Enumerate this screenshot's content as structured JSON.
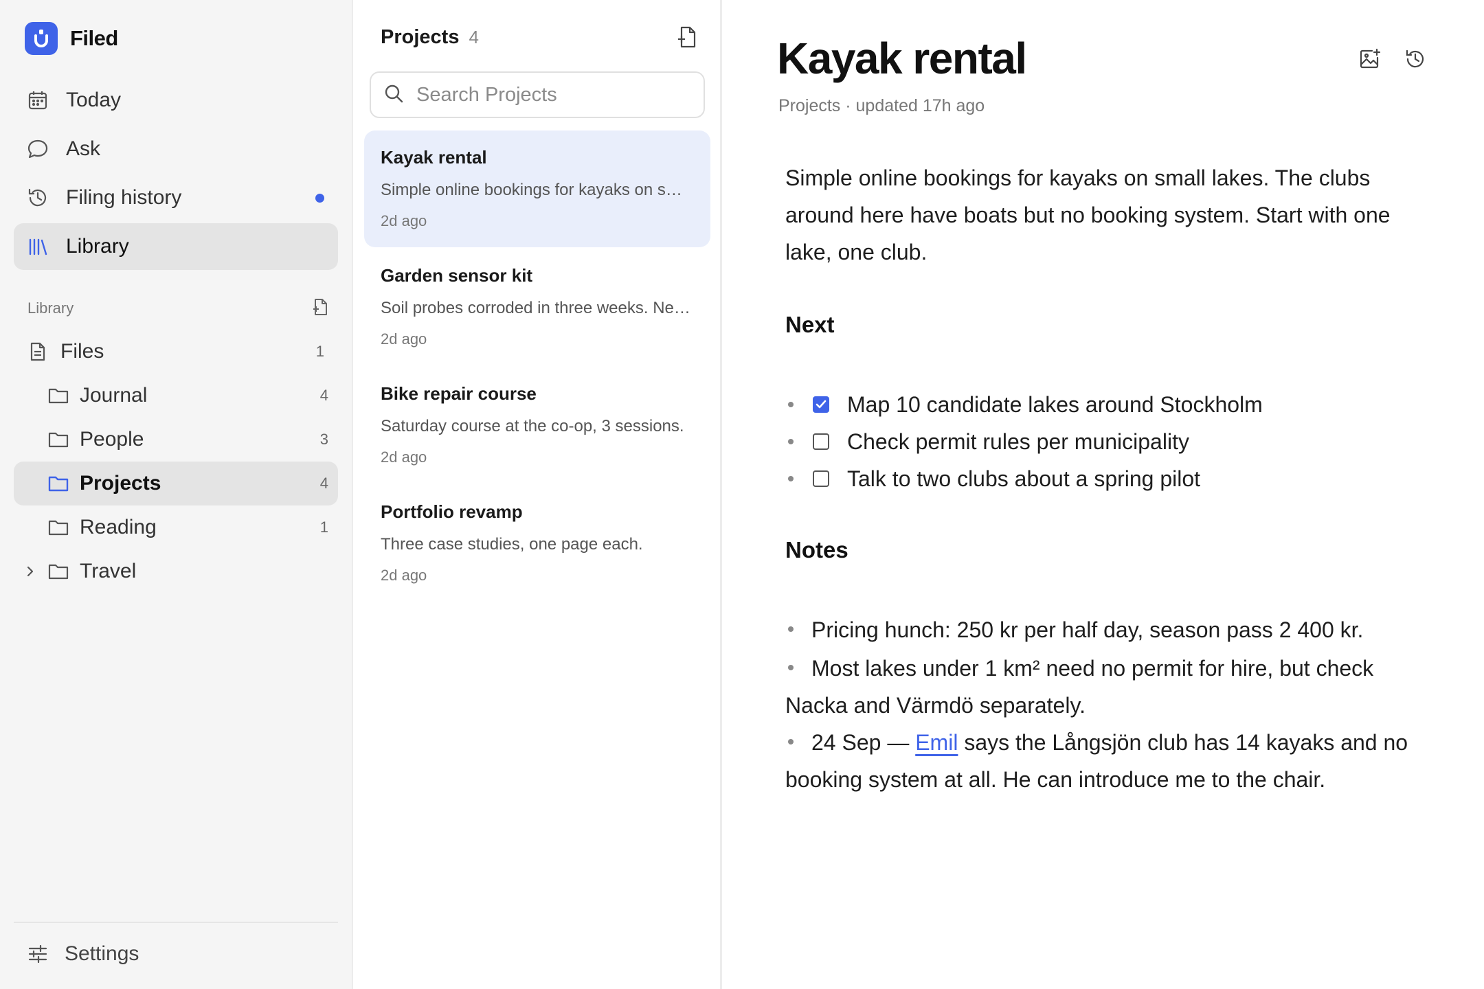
{
  "app": {
    "name": "Filed",
    "accent": "#3f63e8"
  },
  "sidebar": {
    "nav": [
      {
        "label": "Today",
        "icon": "calendar-icon"
      },
      {
        "label": "Ask",
        "icon": "chat-bubble-icon"
      },
      {
        "label": "Filing history",
        "icon": "history-icon",
        "has_unread_dot": true
      },
      {
        "label": "Library",
        "icon": "library-icon",
        "active": true
      }
    ],
    "library_header": "Library",
    "tree": [
      {
        "label": "Files",
        "count": "1",
        "icon": "file-icon"
      },
      {
        "label": "Journal",
        "count": "4",
        "icon": "folder-icon"
      },
      {
        "label": "People",
        "count": "3",
        "icon": "folder-icon"
      },
      {
        "label": "Projects",
        "count": "4",
        "icon": "folder-icon",
        "active": true
      },
      {
        "label": "Reading",
        "count": "1",
        "icon": "folder-icon"
      },
      {
        "label": "Travel",
        "count": "",
        "icon": "folder-icon",
        "collapsed": true
      }
    ],
    "settings_label": "Settings"
  },
  "list": {
    "title": "Projects",
    "count": "4",
    "search_placeholder": "Search Projects",
    "items": [
      {
        "title": "Kayak rental",
        "snippet": "Simple online bookings for kayaks on small lakes.",
        "time": "2d ago",
        "active": true
      },
      {
        "title": "Garden sensor kit",
        "snippet": "Soil probes corroded in three weeks. Need a better coating.",
        "time": "2d ago"
      },
      {
        "title": "Bike repair course",
        "snippet": "Saturday course at the co-op, 3 sessions.",
        "time": "2d ago"
      },
      {
        "title": "Portfolio revamp",
        "snippet": "Three case studies, one page each.",
        "time": "2d ago"
      }
    ]
  },
  "document": {
    "title": "Kayak rental",
    "meta": "Projects · updated 17h ago",
    "intro": "Simple online bookings for kayaks on small lakes. The clubs around here have boats but no booking system. Start with one lake, one club.",
    "next_heading": "Next",
    "tasks": [
      {
        "text": "Map 10 candidate lakes around Stockholm",
        "done": true
      },
      {
        "text": "Check permit rules per municipality",
        "done": false
      },
      {
        "text": "Talk to two clubs about a spring pilot",
        "done": false
      }
    ],
    "notes_heading": "Notes",
    "notes": {
      "n1": "Pricing hunch: 250 kr per half day, season pass 2 400 kr.",
      "n2": "Most lakes under 1 km² need no permit for hire, but check Nacka and Värmdö separately.",
      "n3_pre": "24 Sep — ",
      "n3_link": "Emil",
      "n3_post": " says the Långsjön club has 14 kayaks and no booking system at all. He can introduce me to the chair."
    }
  }
}
